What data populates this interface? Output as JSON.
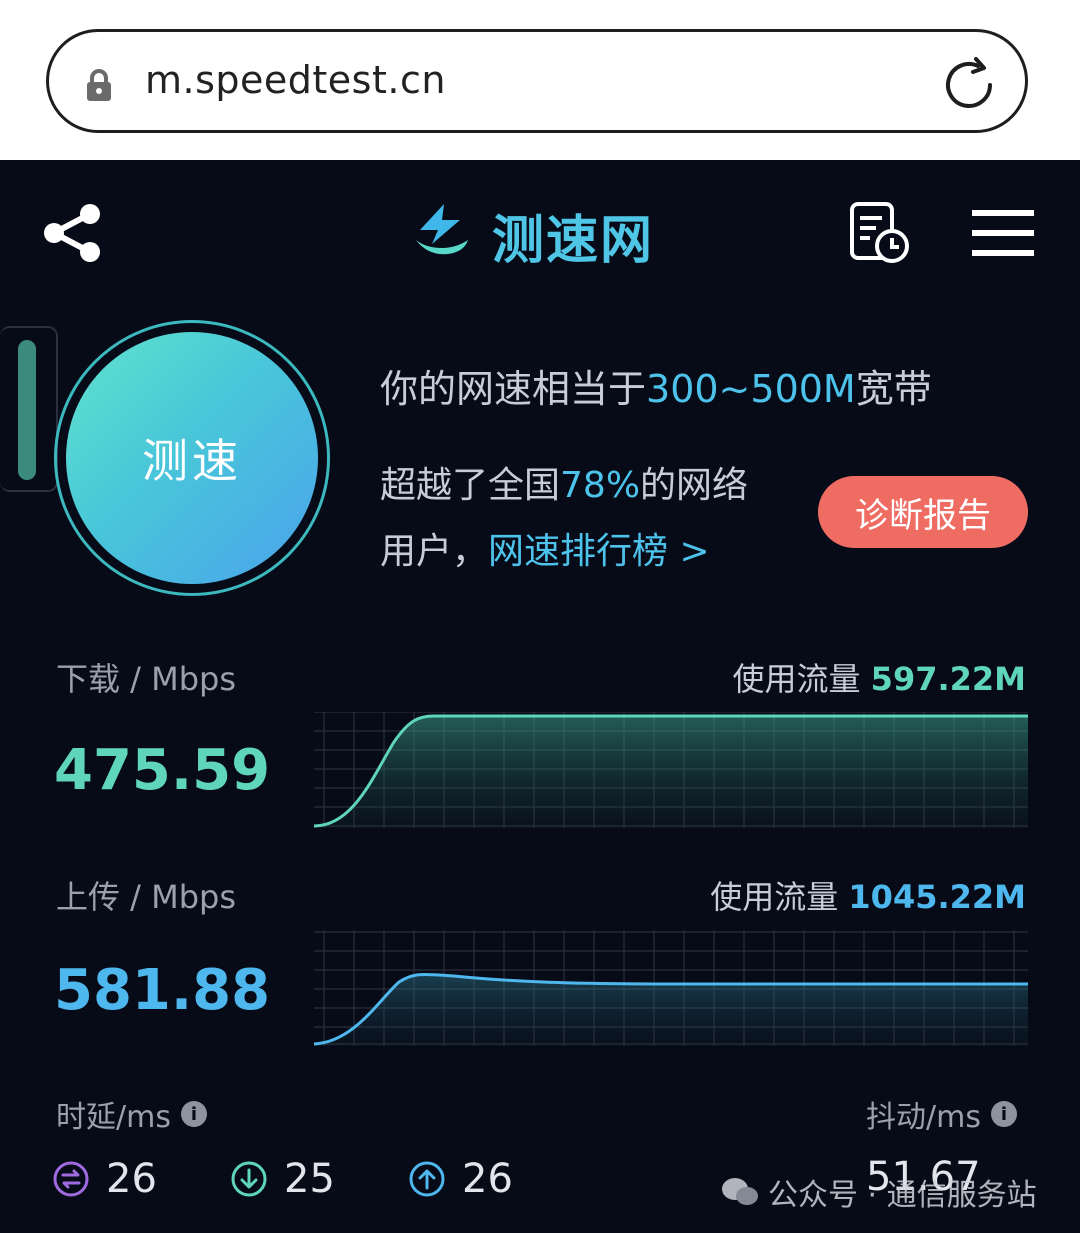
{
  "address_bar": {
    "url": "m.speedtest.cn"
  },
  "header": {
    "brand": "测速网"
  },
  "test_button": {
    "label": "测速"
  },
  "summary": {
    "prefix": "你的网速相当于",
    "range": "300~500M",
    "suffix": "宽带",
    "line2_prefix": "超越了全国",
    "percent": "78%",
    "line2_suffix": "的网络",
    "line3_prefix": "用户，",
    "rank_link": "网速排行榜 >",
    "diagnose_button": "诊断报告"
  },
  "download": {
    "label": "下载 / Mbps",
    "value": "475.59",
    "usage_label": "使用流量",
    "usage_value": "597.22M",
    "color": "#5fd6bc"
  },
  "upload": {
    "label": "上传 / Mbps",
    "value": "581.88",
    "usage_label": "使用流量",
    "usage_value": "1045.22M",
    "color": "#4db7ee"
  },
  "latency": {
    "label": "时延/ms",
    "info_icon": "i",
    "idle": "26",
    "download": "25",
    "upload": "26"
  },
  "jitter": {
    "label": "抖动/ms",
    "info_icon": "i",
    "value": "51.67"
  },
  "watermark": {
    "text": "公众号 · 通信服务站"
  }
}
